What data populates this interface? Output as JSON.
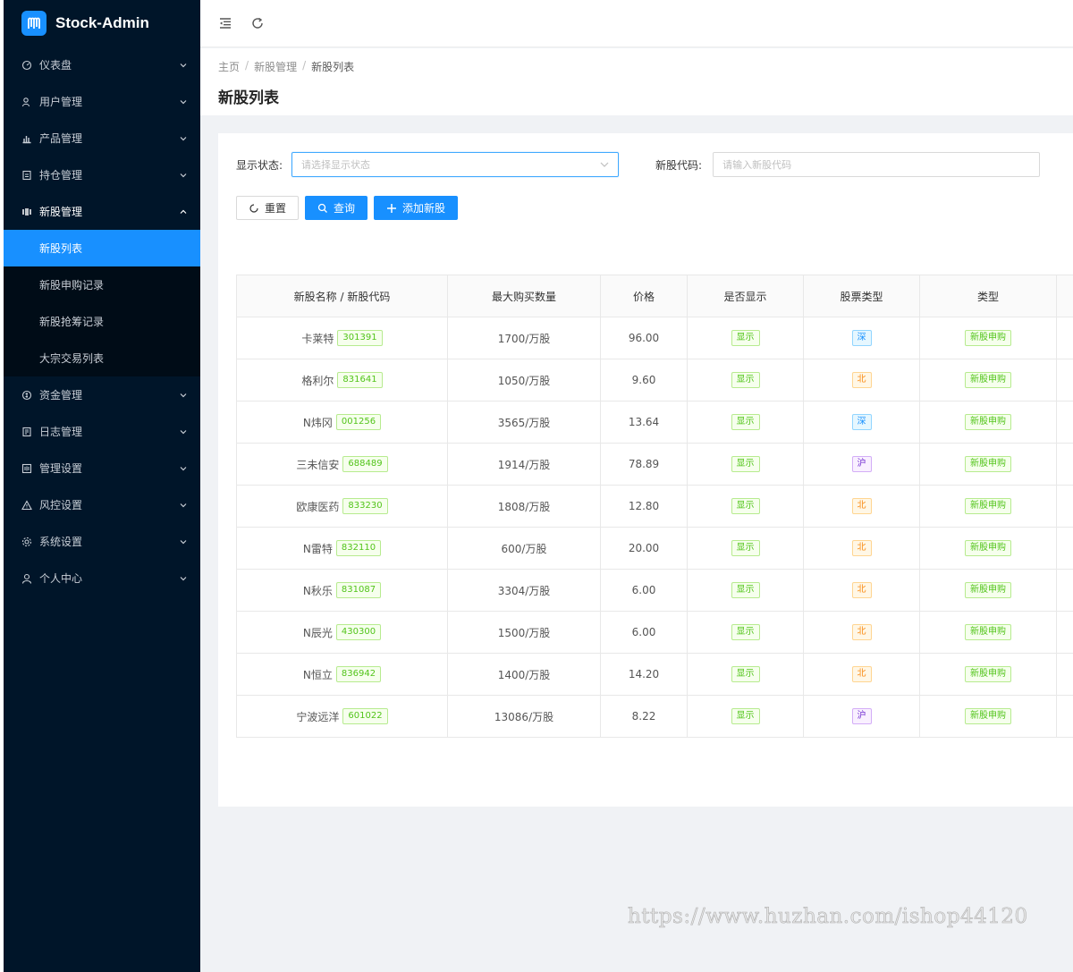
{
  "app": {
    "title": "Stock-Admin"
  },
  "sidebar": {
    "items": [
      {
        "label": "仪表盘",
        "icon": "dashboard-icon"
      },
      {
        "label": "用户管理",
        "icon": "users-icon"
      },
      {
        "label": "产品管理",
        "icon": "chart-bar-icon"
      },
      {
        "label": "持仓管理",
        "icon": "position-icon"
      },
      {
        "label": "新股管理",
        "icon": "ipo-icon",
        "open": true,
        "children": [
          {
            "label": "新股列表",
            "active": true
          },
          {
            "label": "新股申购记录"
          },
          {
            "label": "新股抢筹记录"
          },
          {
            "label": "大宗交易列表"
          }
        ]
      },
      {
        "label": "资金管理",
        "icon": "money-icon"
      },
      {
        "label": "日志管理",
        "icon": "log-icon"
      },
      {
        "label": "管理设置",
        "icon": "admin-settings-icon"
      },
      {
        "label": "风控设置",
        "icon": "warning-icon"
      },
      {
        "label": "系统设置",
        "icon": "gear-icon"
      },
      {
        "label": "个人中心",
        "icon": "user-icon"
      }
    ]
  },
  "breadcrumb": [
    "主页",
    "新股管理",
    "新股列表"
  ],
  "page": {
    "title": "新股列表"
  },
  "filters": {
    "status_label": "显示状态:",
    "status_placeholder": "请选择显示状态",
    "code_label": "新股代码:",
    "code_placeholder": "请输入新股代码"
  },
  "buttons": {
    "reset": "重置",
    "search": "查询",
    "add": "添加新股"
  },
  "table": {
    "headers": [
      "新股名称 / 新股代码",
      "最大购买数量",
      "价格",
      "是否显示",
      "股票类型",
      "类型"
    ],
    "rows": [
      {
        "name": "卡莱特",
        "code": "301391",
        "max": "1700/万股",
        "price": "96.00",
        "show": "显示",
        "market": "深",
        "type": "新股申购"
      },
      {
        "name": "格利尔",
        "code": "831641",
        "max": "1050/万股",
        "price": "9.60",
        "show": "显示",
        "market": "北",
        "type": "新股申购"
      },
      {
        "name": "N炜冈",
        "code": "001256",
        "max": "3565/万股",
        "price": "13.64",
        "show": "显示",
        "market": "深",
        "type": "新股申购"
      },
      {
        "name": "三未信安",
        "code": "688489",
        "max": "1914/万股",
        "price": "78.89",
        "show": "显示",
        "market": "沪",
        "type": "新股申购"
      },
      {
        "name": "欧康医药",
        "code": "833230",
        "max": "1808/万股",
        "price": "12.80",
        "show": "显示",
        "market": "北",
        "type": "新股申购"
      },
      {
        "name": "N雷特",
        "code": "832110",
        "max": "600/万股",
        "price": "20.00",
        "show": "显示",
        "market": "北",
        "type": "新股申购"
      },
      {
        "name": "N秋乐",
        "code": "831087",
        "max": "3304/万股",
        "price": "6.00",
        "show": "显示",
        "market": "北",
        "type": "新股申购"
      },
      {
        "name": "N辰光",
        "code": "430300",
        "max": "1500/万股",
        "price": "6.00",
        "show": "显示",
        "market": "北",
        "type": "新股申购"
      },
      {
        "name": "N恒立",
        "code": "836942",
        "max": "1400/万股",
        "price": "14.20",
        "show": "显示",
        "market": "北",
        "type": "新股申购"
      },
      {
        "name": "宁波远洋",
        "code": "601022",
        "max": "13086/万股",
        "price": "8.22",
        "show": "显示",
        "market": "沪",
        "type": "新股申购"
      }
    ]
  },
  "colors": {
    "primary": "#1890ff",
    "sidebar": "#001529",
    "sz": "#1890ff",
    "bj": "#fa8c16",
    "sh": "#722ed1",
    "green": "#52c41a"
  },
  "watermark": "https://www.huzhan.com/ishop44120"
}
